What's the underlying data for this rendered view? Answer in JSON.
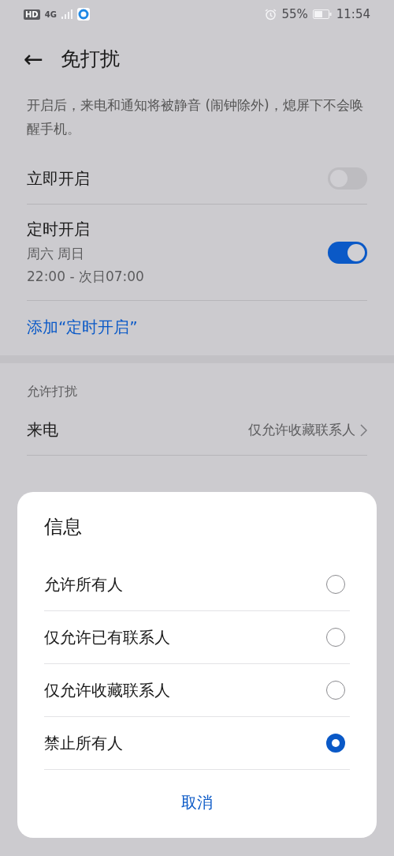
{
  "status_bar": {
    "hd_label": "HD",
    "network_label": "4G",
    "battery_text": "55%",
    "time": "11:54"
  },
  "header": {
    "back_glyph": "←",
    "title": "免打扰"
  },
  "description": "开启后，来电和通知将被静音 (闹钟除外)，熄屏下不会唤醒手机。",
  "settings": [
    {
      "kind": "toggle",
      "label": "立即开启",
      "on": false
    },
    {
      "kind": "toggle",
      "label": "定时开启",
      "details": [
        "周六 周日",
        "22:00 - 次日07:00"
      ],
      "on": true
    }
  ],
  "add_link": "添加“定时开启”",
  "section": {
    "title": "允许打扰",
    "rows": [
      {
        "label": "来电",
        "value": "仅允许收藏联系人"
      }
    ]
  },
  "dialog": {
    "title": "信息",
    "options": [
      {
        "label": "允许所有人",
        "selected": false
      },
      {
        "label": "仅允许已有联系人",
        "selected": false
      },
      {
        "label": "仅允许收藏联系人",
        "selected": false
      },
      {
        "label": "禁止所有人",
        "selected": true
      }
    ],
    "cancel": "取消"
  }
}
